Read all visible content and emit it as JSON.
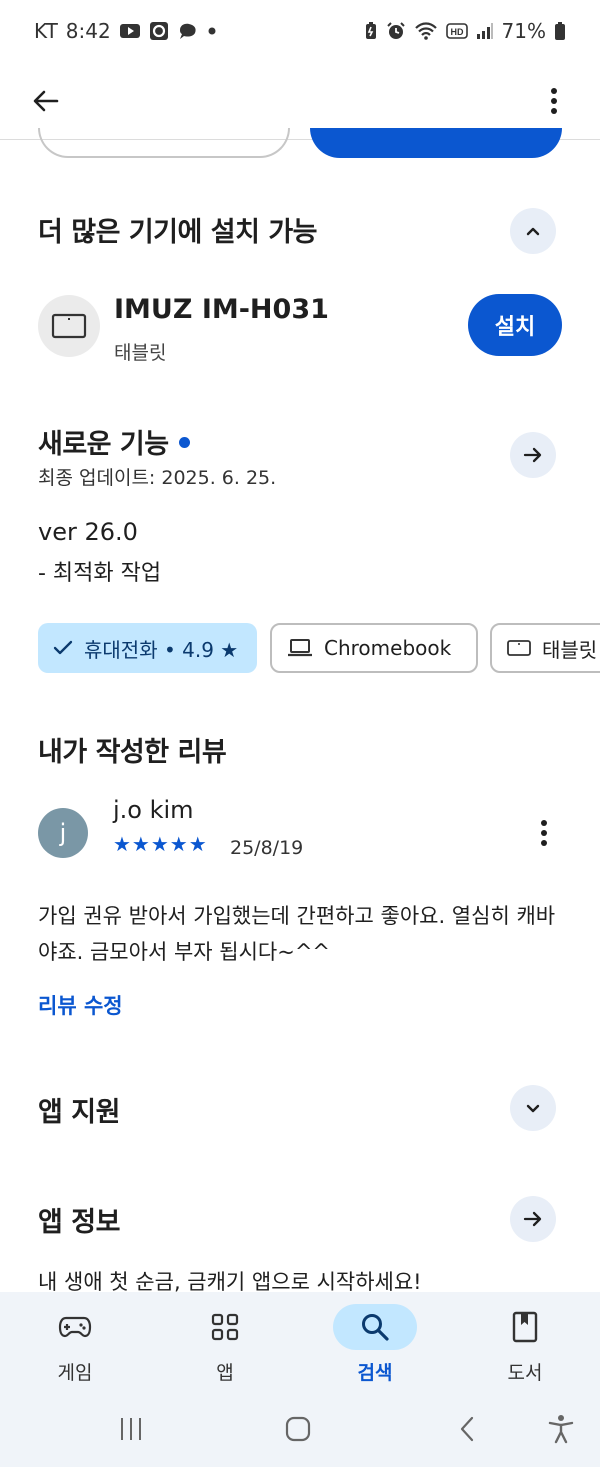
{
  "status_bar": {
    "carrier": "KT",
    "time": "8:42",
    "battery": "71%"
  },
  "sections": {
    "more_devices_title": "더 많은 기기에 설치 가능",
    "whats_new_title": "새로운 기능",
    "my_review_title": "내가 작성한 리뷰",
    "app_support_title": "앱 지원",
    "app_info_title": "앱 정보"
  },
  "device": {
    "name": "IMUZ IM-H031",
    "type": "태블릿",
    "install_label": "설치"
  },
  "whats_new": {
    "updated": "최종 업데이트: 2025. 6. 25.",
    "version": "ver 26.0",
    "note": "- 최적화 작업"
  },
  "chips": [
    {
      "label": "휴대전화 • 4.9 ★",
      "selected": true,
      "icon": "check-icon"
    },
    {
      "label": "Chromebook",
      "selected": false,
      "icon": "laptop-icon"
    },
    {
      "label": "태블릿",
      "selected": false,
      "icon": "tablet-icon"
    }
  ],
  "review": {
    "avatar_letter": "j",
    "reviewer": "j.o kim",
    "stars": "★★★★★",
    "rating": 5,
    "date": "25/8/19",
    "text": "가입 권유 받아서 가입했는데 간편하고 좋아요. 열심히 캐바야죠. 금모아서 부자 됩시다~^^",
    "edit_label": "리뷰 수정"
  },
  "app_info": {
    "description": "내 생애 첫 순금, 금캐기 앱으로 시작하세요!"
  },
  "bottom_nav": [
    {
      "label": "게임",
      "icon": "gamepad-icon",
      "active": false
    },
    {
      "label": "앱",
      "icon": "apps-icon",
      "active": false
    },
    {
      "label": "검색",
      "icon": "search-icon",
      "active": true
    },
    {
      "label": "도서",
      "icon": "book-icon",
      "active": false
    }
  ],
  "colors": {
    "accent": "#0b57d0",
    "chip_selected_bg": "#c2e7ff",
    "round_button_bg": "#e8eef7",
    "nav_bg": "#f0f4f9"
  }
}
